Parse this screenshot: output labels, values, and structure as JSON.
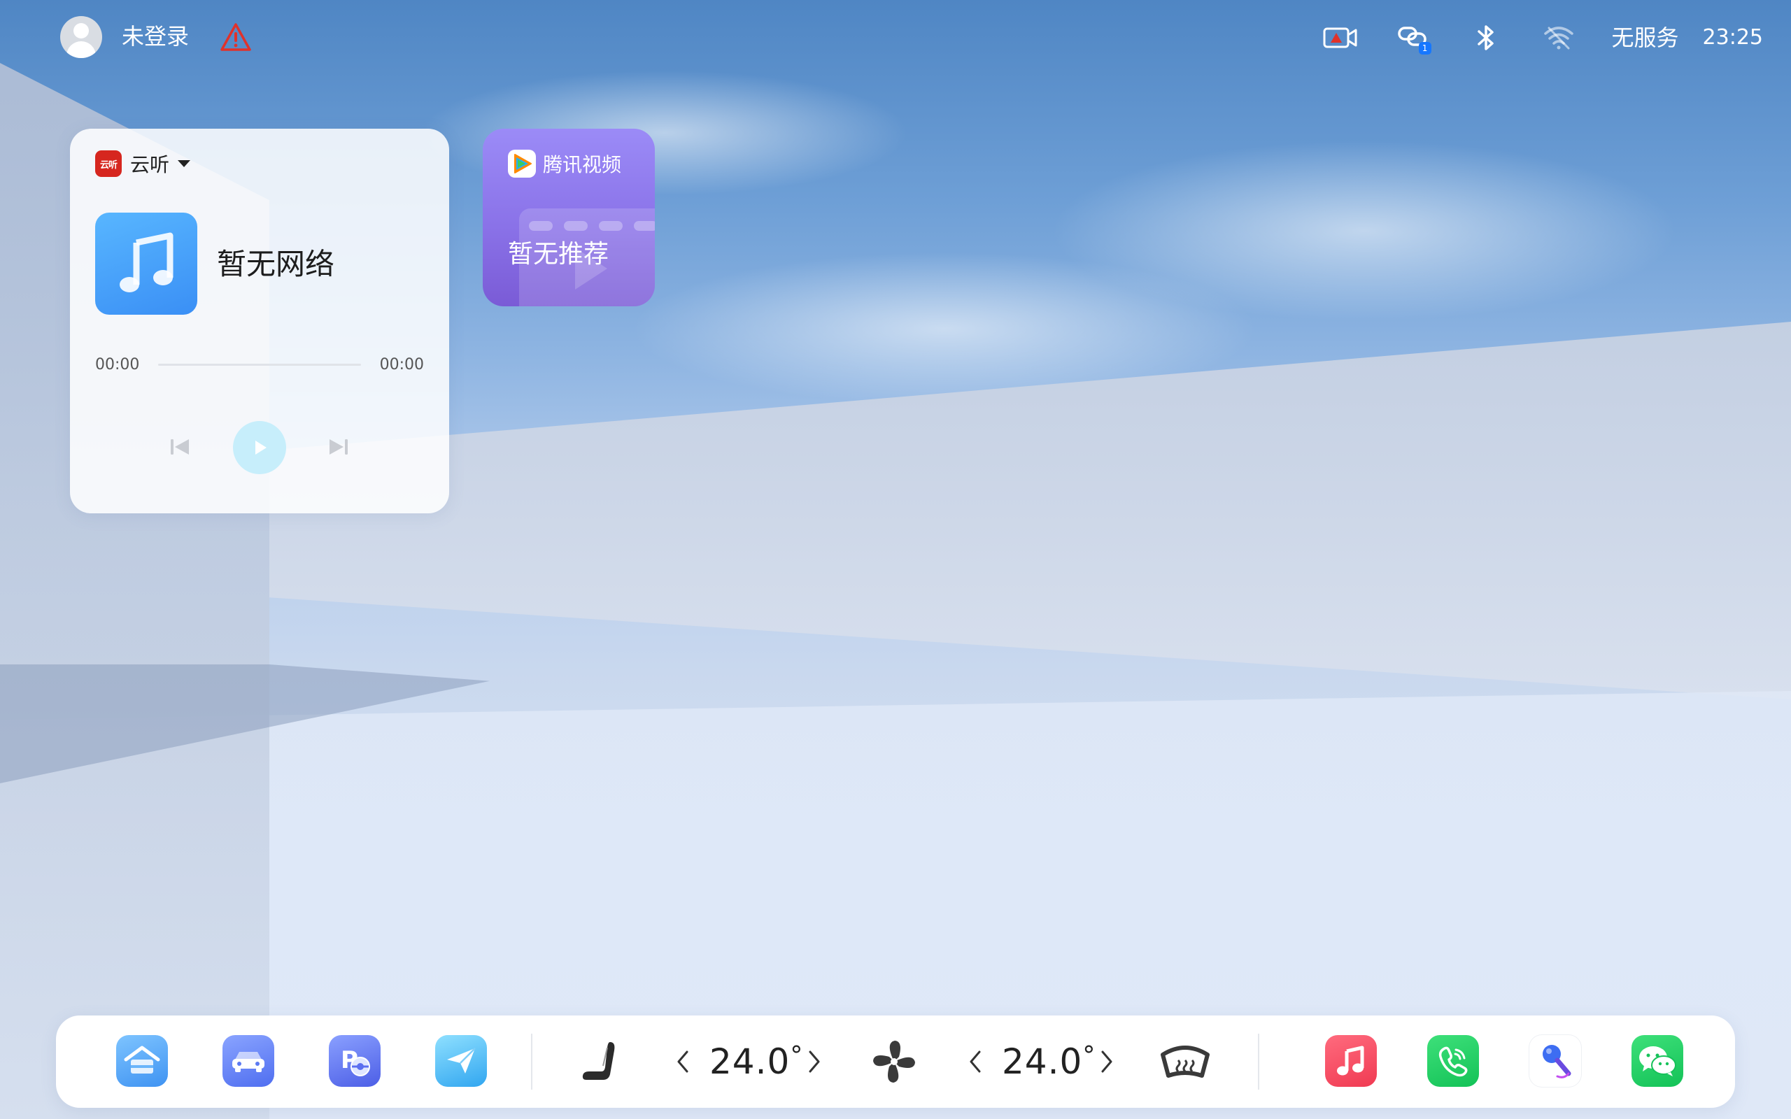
{
  "status_bar": {
    "login_status": "未登录",
    "network_status": "无服务",
    "time": "23:25",
    "notification_badge": "1",
    "icons": [
      "avatar-icon",
      "warning-icon",
      "dashcam-icon",
      "connection-icon",
      "bluetooth-icon",
      "wifi-off-icon"
    ]
  },
  "music_widget": {
    "app_name": "云听",
    "app_logo_text": "云听",
    "track_title": "暂无网络",
    "time_elapsed": "00:00",
    "time_total": "00:00",
    "progress": 0,
    "controls": [
      "previous-icon",
      "play-icon",
      "next-icon"
    ]
  },
  "video_widget": {
    "app_name": "腾讯视频",
    "message": "暂无推荐"
  },
  "dock": {
    "left_apps": [
      "home-app-icon",
      "car-app-icon",
      "parking-app-icon",
      "navigation-app-icon"
    ],
    "climate": {
      "driver_temp": "24.0",
      "passenger_temp": "24.0",
      "degree_symbol": "°",
      "icons": [
        "seat-heating-icon",
        "fan-icon",
        "rear-defrost-icon"
      ]
    },
    "right_apps": [
      "music-app-icon",
      "phone-app-icon",
      "karaoke-app-icon",
      "wechat-app-icon"
    ]
  },
  "colors": {
    "music_app_blue": "#3a8ff5",
    "yunting_red": "#d6261f",
    "video_purple": "#8a72e8",
    "play_button": "#c7eefb",
    "warning_red": "#e0322b"
  }
}
